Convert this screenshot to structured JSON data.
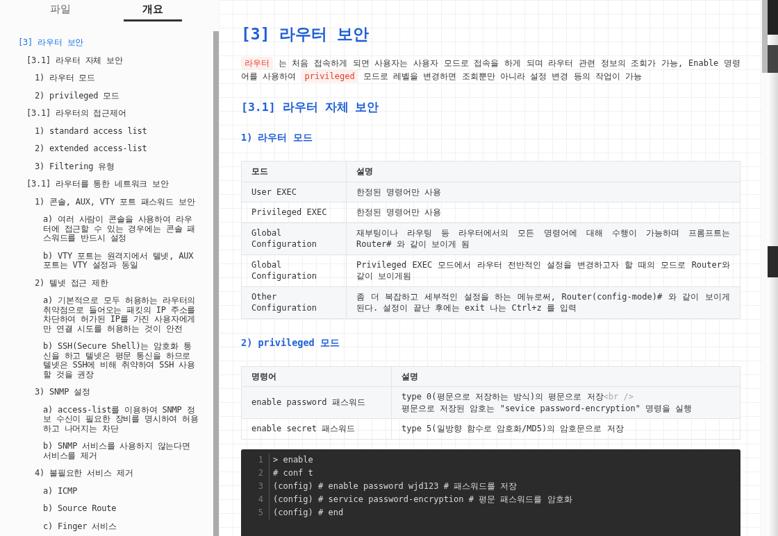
{
  "sidebar": {
    "tabs": [
      {
        "label": "파일",
        "selected": false
      },
      {
        "label": "개요",
        "selected": true
      }
    ],
    "outline": [
      {
        "label": "[3] 라우터 보안",
        "selected": true,
        "children": [
          {
            "label": "[3.1] 라우터 자체 보안",
            "selected": false,
            "children": [
              {
                "label": "1) 라우터 모드",
                "selected": false
              },
              {
                "label": "2) privileged 모드",
                "selected": false
              }
            ]
          },
          {
            "label": "[3.1] 라우터의 접근제어",
            "selected": false,
            "children": [
              {
                "label": "1) standard access list",
                "selected": false
              },
              {
                "label": "2) extended access-list",
                "selected": false
              },
              {
                "label": "3) Filtering 유형",
                "selected": false
              }
            ]
          },
          {
            "label": "[3.1] 라우터를 통한 네트워크 보안",
            "selected": false,
            "children": [
              {
                "label": "1) 콘솔, AUX, VTY 포트 패스워드 보안",
                "selected": false,
                "children": [
                  {
                    "label": "a) 여러 사람이 콘솔을 사용하여 라우터에 접근할 수 있는 경우에는 콘솔 패스워드를 반드시 설정",
                    "selected": false
                  },
                  {
                    "label": "b) VTY 포트는 원격지에서 텔넷, AUX 포트는 VTY 설정과 동일",
                    "selected": false
                  }
                ]
              },
              {
                "label": "2) 텔넷 접근 제한",
                "selected": false,
                "children": [
                  {
                    "label": "a) 기본적으로 모두 허용하는 라우터의 취약점으로 들어오는 패킷의 IP 주소를 차단하여 허가된 IP를 가진 사용자에게만 연결 시도를 허용하는 것이 안전",
                    "selected": false
                  },
                  {
                    "label": "b) SSH(Secure Shell)는 암호화 통신을 하고 텔넷은 평문 통신을 하므로 텔넷은 SSH에 비해 취약하여 SSH 사용할 것을 권장",
                    "selected": false
                  }
                ]
              },
              {
                "label": "3) SNMP 설정",
                "selected": false,
                "children": [
                  {
                    "label": "a) access-list를 이용하여 SNMP 정보 수신이 필요한 장비를 명시하여 허용하고 나머지는 차단",
                    "selected": false
                  },
                  {
                    "label": "b) SNMP 서비스를 사용하지 않는다면 서비스를 제거",
                    "selected": false
                  }
                ]
              },
              {
                "label": "4) 불필요한 서비스 제거",
                "selected": false,
                "children": [
                  {
                    "label": "a) ICMP",
                    "selected": false
                  },
                  {
                    "label": "b) Source Route",
                    "selected": false
                  },
                  {
                    "label": "c) Finger 서비스",
                    "selected": false
                  }
                ]
              }
            ]
          }
        ]
      }
    ]
  },
  "document": {
    "blocks": [
      {
        "kind": "h1",
        "text": "[3] 라우터 보안"
      },
      {
        "kind": "paragraph",
        "segments": [
          {
            "kind": "code",
            "text": "라우터"
          },
          {
            "kind": "text",
            "text": " 는 처음 접속하게 되면 사용자는 사용자 모드로 접속을 하게 되며 라우터 관련 정보의 조회가 가능, Enable 명령어를 사용하여 "
          },
          {
            "kind": "code",
            "text": "privileged"
          },
          {
            "kind": "text",
            "text": " 모드로 레벨을 변경하면 조회뿐만 아니라 설정 변경 등의 작업이 가능"
          }
        ]
      },
      {
        "kind": "h2",
        "text": "[3.1] 라우터 자체 보안"
      },
      {
        "kind": "h3",
        "text": "1) 라우터 모드"
      },
      {
        "kind": "table",
        "columns": [
          "모드",
          "설명"
        ],
        "rows": [
          [
            [
              {
                "kind": "text",
                "text": "User EXEC"
              }
            ],
            [
              {
                "kind": "text",
                "text": "한정된 명령어만 사용"
              }
            ]
          ],
          [
            [
              {
                "kind": "text",
                "text": "Privileged EXEC"
              }
            ],
            [
              {
                "kind": "text",
                "text": "한정된 명령어만 사용"
              }
            ]
          ],
          [
            [
              {
                "kind": "text",
                "text": "Global Configuration"
              }
            ],
            [
              {
                "kind": "text",
                "text": "재부팅이나 라우팅 등 라우터에서의 모든 명령어에 대해 수행이 가능하며 프롬프트는 Router# 와 같이 보이게 됨"
              }
            ]
          ],
          [
            [
              {
                "kind": "text",
                "text": "Global Configuration"
              }
            ],
            [
              {
                "kind": "text",
                "text": "Privileged EXEC 모드에서 라우터 전반적인 설정을 변경하고자 할 때의 모드로 Router와 같이 보이게됨"
              }
            ]
          ],
          [
            [
              {
                "kind": "text",
                "text": "Other Configuration"
              }
            ],
            [
              {
                "kind": "text",
                "text": "좀 더 복잡하고 세부적인 설정을 하는 메뉴로써, Router(config-mode)# 와 같이 보이게 된다. 설정이 끝난 후에는 exit 나는 Ctrl+z 를 입력"
              }
            ]
          ]
        ]
      },
      {
        "kind": "h3",
        "text": "2) privileged 모드"
      },
      {
        "kind": "table",
        "columns": [
          "명령어",
          "설명"
        ],
        "rows": [
          [
            [
              {
                "kind": "text",
                "text": "enable password 패스워드"
              }
            ],
            [
              {
                "kind": "text",
                "text": "type 0(평문으로 저장하는 방식)의 평문으로 저장"
              },
              {
                "kind": "markup",
                "text": "<br />"
              },
              {
                "kind": "break"
              },
              {
                "kind": "text",
                "text": "평문으로 저장된 암호는 \"sevice password-encryption\" 명령을 실행"
              }
            ]
          ],
          [
            [
              {
                "kind": "text",
                "text": "enable secret 패스워드"
              }
            ],
            [
              {
                "kind": "text",
                "text": "type 5(일방향 함수로 암호화/MD5)의 암호문으로 저장"
              }
            ]
          ]
        ]
      },
      {
        "kind": "code",
        "lines": [
          {
            "number": "1",
            "text": "> enable"
          },
          {
            "number": "2",
            "text": "# conf t"
          },
          {
            "number": "3",
            "text": "(config) # enable password wjd123 # 패스워드를 저장"
          },
          {
            "number": "4",
            "text": "(config) # service password-encryption # 평문 패스워드를 암호화"
          },
          {
            "number": "5",
            "text": "(config) # end"
          }
        ]
      }
    ]
  }
}
